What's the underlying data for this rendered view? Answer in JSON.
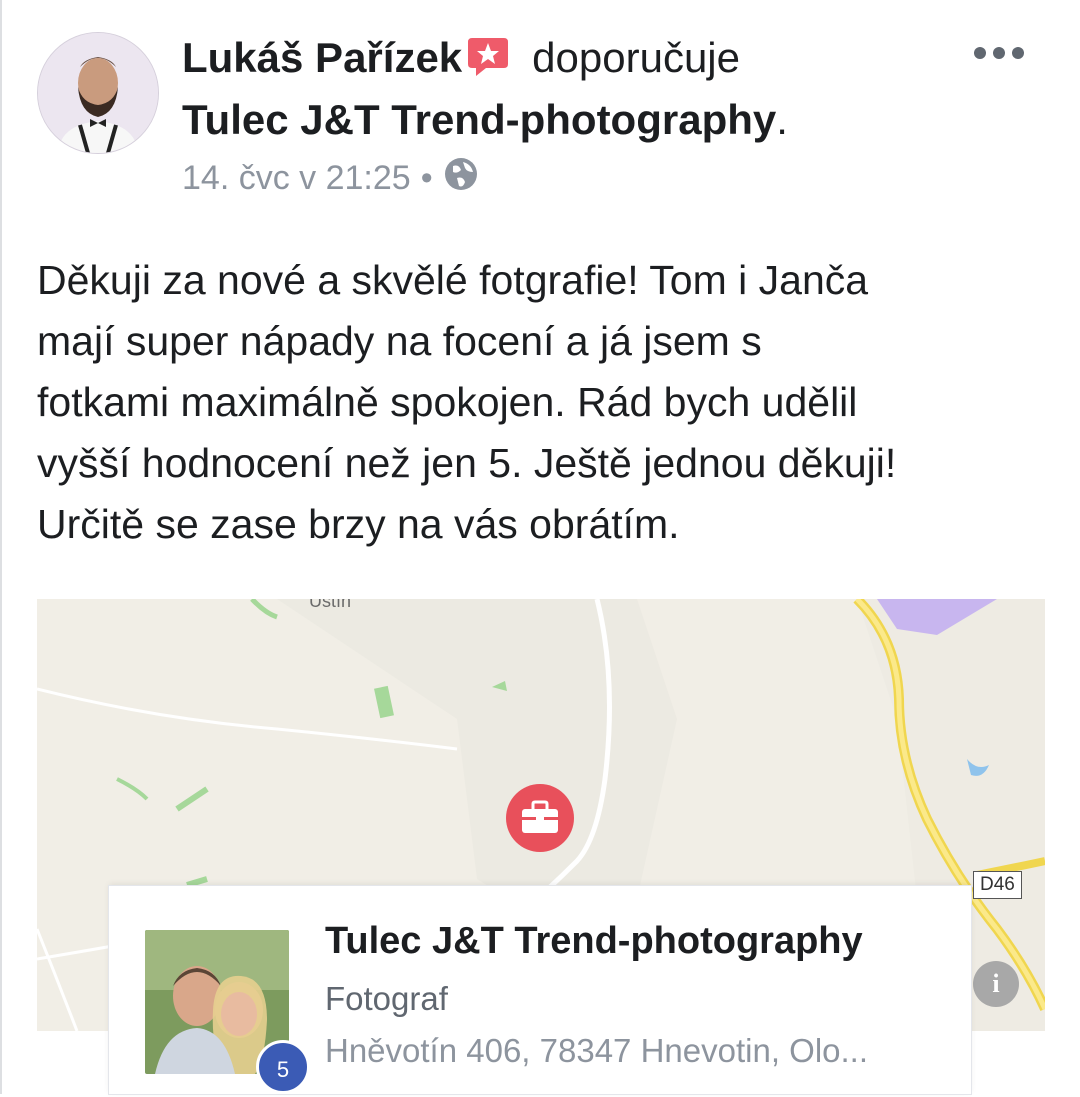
{
  "post": {
    "author": "Lukáš Pařízek",
    "verb": "doporučuje",
    "page_name": "Tulec J&T Trend-photography",
    "page_suffix": ".",
    "timestamp": "14. čvc v 21:25",
    "separator": "•",
    "privacy_icon": "globe-icon",
    "more_icon": "more-options-icon",
    "text_lines": [
      "Děkuji za nové a skvělé fotgrafie! Tom i Janča",
      "mají super nápady na focení a já jsem s",
      "fotkami maximálně spokojen. Rád bych udělil",
      "vyšší hodnocení než jen 5. Ještě jednou děkuji!",
      "Určitě se zase brzy na vás obrátím."
    ]
  },
  "map": {
    "place_label": "Ústín",
    "road_label": "D46",
    "marker_icon": "briefcase-icon",
    "marker_color": "#e8505b",
    "info_label": "i"
  },
  "card": {
    "title": "Tulec J&T Trend-photography",
    "category": "Fotograf",
    "address": "Hněvotín 406, 78347 Hnevotin, Olo...",
    "rating": "5",
    "rating_color": "#3b5bb5"
  }
}
